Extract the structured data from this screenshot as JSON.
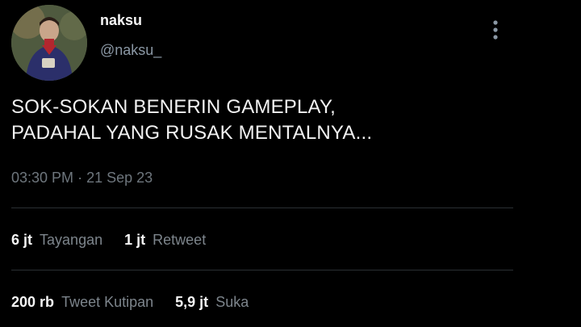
{
  "user": {
    "display_name": "naksu",
    "handle": "@naksu_"
  },
  "tweet": {
    "lines": [
      "SOK-SOKAN BENERIN GAMEPLAY,",
      "PADAHAL YANG RUSAK MENTALNYA..."
    ],
    "time": "03:30 PM",
    "separator": "·",
    "date": "21 Sep 23"
  },
  "stats_row_1": [
    {
      "value": "6 jt",
      "label": "Tayangan"
    },
    {
      "value": "1 jt",
      "label": "Retweet"
    }
  ],
  "stats_row_2": [
    {
      "value": "200 rb",
      "label": "Tweet Kutipan"
    },
    {
      "value": "5,9 jt",
      "label": "Suka"
    }
  ],
  "icons": {
    "more": "more-vertical-icon"
  },
  "colors": {
    "background": "#000000",
    "text_primary": "#f2f2f2",
    "text_secondary": "#8b98a5",
    "divider": "#2a2f33"
  }
}
